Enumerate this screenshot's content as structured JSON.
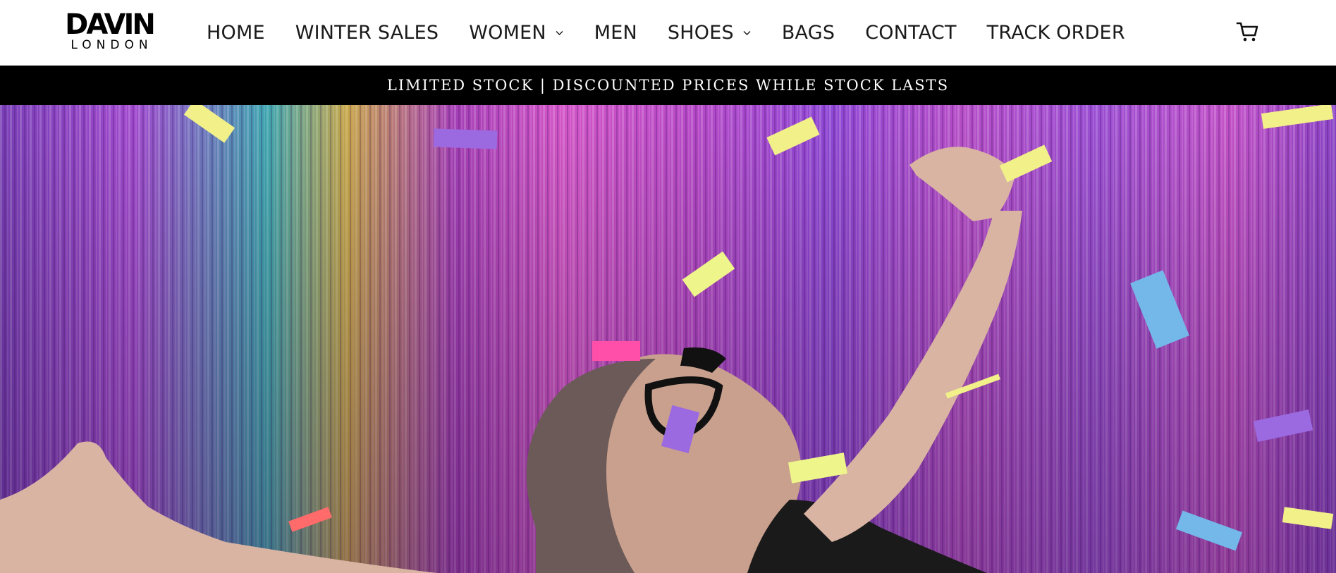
{
  "logo": {
    "main": "DAVIN",
    "sub": "LONDON"
  },
  "nav": {
    "items": [
      {
        "label": "HOME",
        "dropdown": false
      },
      {
        "label": "WINTER SALES",
        "dropdown": false
      },
      {
        "label": "WOMEN",
        "dropdown": true
      },
      {
        "label": "MEN",
        "dropdown": false
      },
      {
        "label": "SHOES",
        "dropdown": true
      },
      {
        "label": "BAGS",
        "dropdown": false
      },
      {
        "label": "CONTACT",
        "dropdown": false
      },
      {
        "label": "TRACK ORDER",
        "dropdown": false
      }
    ]
  },
  "header": {
    "cart_icon": "cart-icon"
  },
  "announcement": {
    "text": "LIMITED STOCK | DISCOUNTED PRICES WHILE STOCK LASTS"
  },
  "hero": {
    "image": "woman-with-confetti-and-tinsel-curtain"
  },
  "colors": {
    "header_bg": "#ffffff",
    "announcement_bg": "#000000",
    "announcement_text": "#ffffff",
    "nav_text": "#1a1a1a"
  }
}
